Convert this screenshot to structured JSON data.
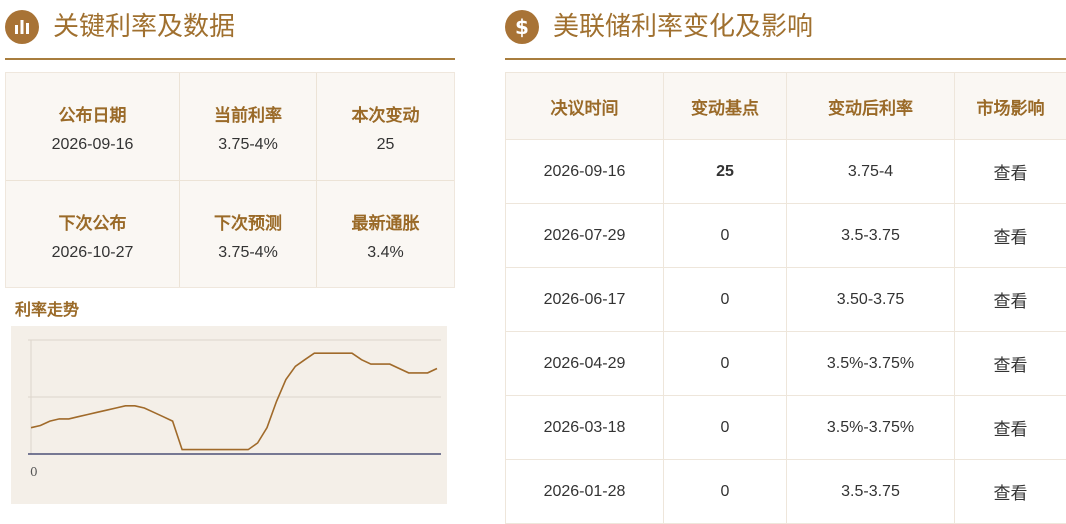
{
  "left": {
    "title": "关键利率及数据",
    "icon": "bar-chart-icon",
    "stats": [
      {
        "label": "公布日期",
        "value": "2026-09-16"
      },
      {
        "label": "当前利率",
        "value": "3.75-4%"
      },
      {
        "label": "本次变动",
        "value": "25"
      },
      {
        "label": "下次公布",
        "value": "2026-10-27"
      },
      {
        "label": "下次预测",
        "value": "3.75-4%"
      },
      {
        "label": "最新通胀",
        "value": "3.4%"
      }
    ],
    "trend_title": "利率走势",
    "axis_zero": "0"
  },
  "right": {
    "title": "美联储利率变化及影响",
    "icon": "dollar-icon",
    "headers": [
      "决议时间",
      "变动基点",
      "变动后利率",
      "市场影响"
    ],
    "rows": [
      {
        "date": "2026-09-16",
        "bp": "25",
        "rate": "3.75-4",
        "impact": "查看"
      },
      {
        "date": "2026-07-29",
        "bp": "0",
        "rate": "3.5-3.75",
        "impact": "查看"
      },
      {
        "date": "2026-06-17",
        "bp": "0",
        "rate": "3.50-3.75",
        "impact": "查看"
      },
      {
        "date": "2026-04-29",
        "bp": "0",
        "rate": "3.5%-3.75%",
        "impact": "查看"
      },
      {
        "date": "2026-03-18",
        "bp": "0",
        "rate": "3.5%-3.75%",
        "impact": "查看"
      },
      {
        "date": "2026-01-28",
        "bp": "0",
        "rate": "3.5-3.75",
        "impact": "查看"
      }
    ]
  },
  "colors": {
    "accent": "#a87336",
    "label": "#9a6a28",
    "positive": "#e05050",
    "chart_line": "#a06a2a",
    "chart_zero_line": "#2a3060"
  },
  "trend_series": [
    1.2,
    1.3,
    1.5,
    1.6,
    1.6,
    1.7,
    1.8,
    1.9,
    2.0,
    2.1,
    2.2,
    2.2,
    2.1,
    1.9,
    1.7,
    1.5,
    0.2,
    0.2,
    0.2,
    0.2,
    0.2,
    0.2,
    0.2,
    0.2,
    0.5,
    1.2,
    2.4,
    3.4,
    4.0,
    4.3,
    4.6,
    4.6,
    4.6,
    4.6,
    4.6,
    4.3,
    4.1,
    4.1,
    4.1,
    3.9,
    3.7,
    3.7,
    3.7,
    3.9
  ]
}
